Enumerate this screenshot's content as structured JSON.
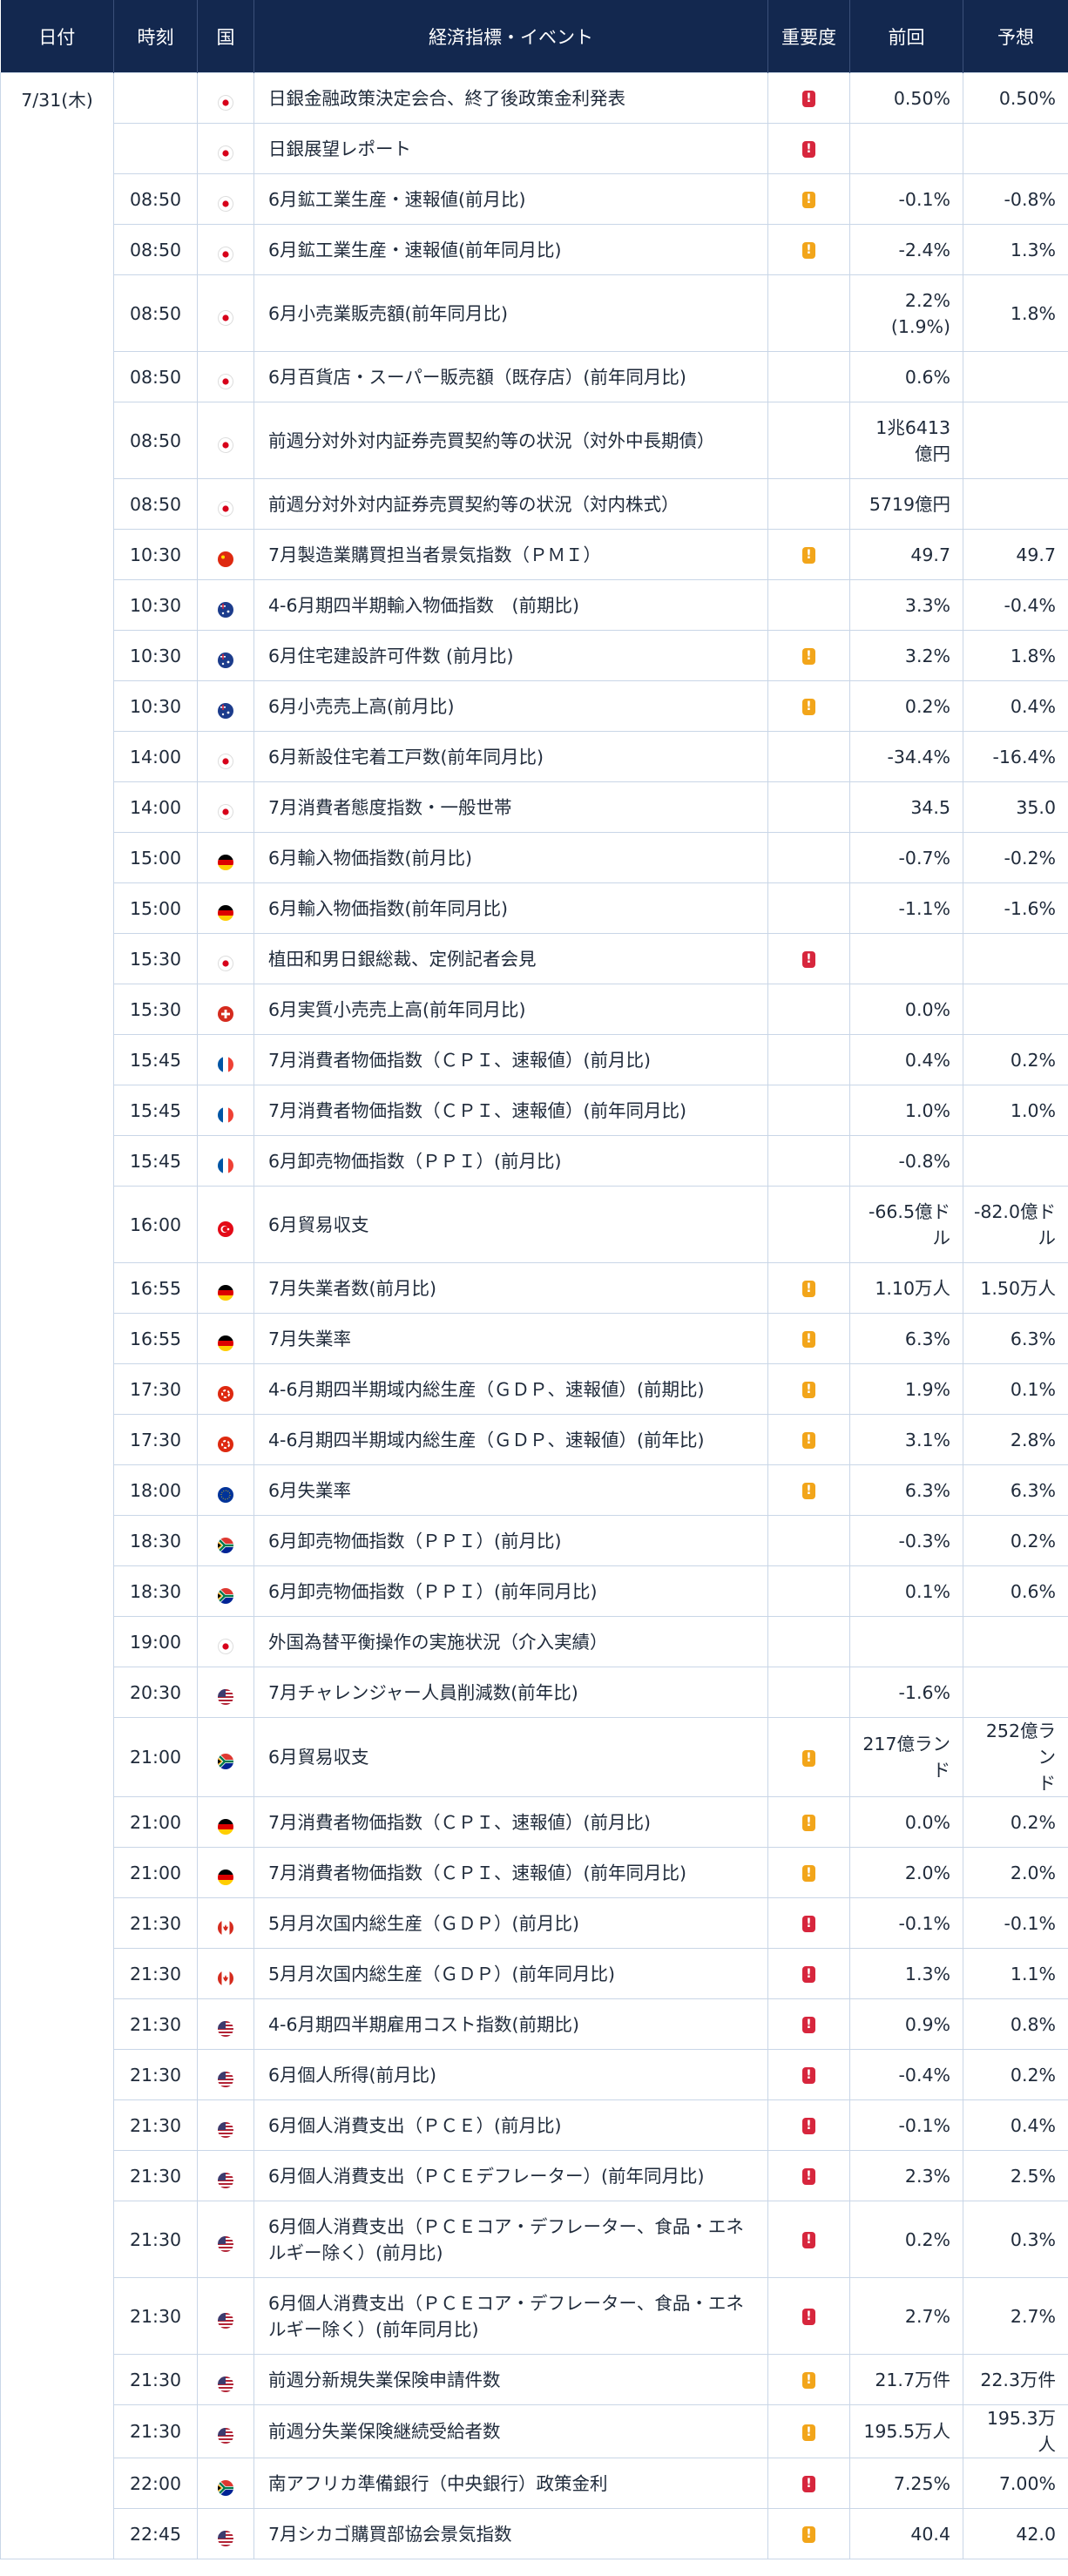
{
  "headers": {
    "date": "日付",
    "time": "時刻",
    "country": "国",
    "event": "経済指標・イベント",
    "importance": "重要度",
    "previous": "前回",
    "forecast": "予想"
  },
  "date": "7/31(木)",
  "flags": {
    "JP": {
      "name": "japan-flag-icon",
      "colors": [
        "#ffffff",
        "#d7001a"
      ]
    },
    "CN": {
      "name": "china-flag-icon",
      "colors": [
        "#de2910",
        "#ffde00"
      ]
    },
    "AU": {
      "name": "australia-flag-icon",
      "colors": [
        "#1c3c8c",
        "#d7263d"
      ]
    },
    "DE": {
      "name": "germany-flag-icon",
      "colors": [
        "#000000",
        "#dd0000",
        "#ffce00"
      ]
    },
    "CH": {
      "name": "switzerland-flag-icon",
      "colors": [
        "#d52b1e",
        "#ffffff"
      ]
    },
    "FR": {
      "name": "france-flag-icon",
      "colors": [
        "#0055a4",
        "#ffffff",
        "#ef4135"
      ]
    },
    "TR": {
      "name": "turkey-flag-icon",
      "colors": [
        "#e30a17",
        "#ffffff"
      ]
    },
    "HK": {
      "name": "hongkong-flag-icon",
      "colors": [
        "#de2910",
        "#ffffff"
      ]
    },
    "EU": {
      "name": "eu-flag-icon",
      "colors": [
        "#003399",
        "#ffcc00"
      ]
    },
    "ZA": {
      "name": "southafrica-flag-icon",
      "colors": [
        "#007a4d",
        "#ffb612",
        "#de3831",
        "#002395"
      ]
    },
    "US": {
      "name": "usa-flag-icon",
      "colors": [
        "#b22234",
        "#ffffff",
        "#3c3b6e"
      ]
    },
    "CA": {
      "name": "canada-flag-icon",
      "colors": [
        "#d52b1e",
        "#ffffff"
      ]
    }
  },
  "importance_colors": {
    "high": "#d7263d",
    "mid": "#f2a51a"
  },
  "importance_glyph": "!",
  "rows": [
    {
      "time": "",
      "country": "JP",
      "event": "日銀金融政策決定会合、終了後政策金利発表",
      "importance": "high",
      "previous": "0.50%",
      "forecast": "0.50%"
    },
    {
      "time": "",
      "country": "JP",
      "event": "日銀展望レポート",
      "importance": "high",
      "previous": "",
      "forecast": ""
    },
    {
      "time": "08:50",
      "country": "JP",
      "event": "6月鉱工業生産・速報値(前月比)",
      "importance": "mid",
      "previous": "-0.1%",
      "forecast": "-0.8%"
    },
    {
      "time": "08:50",
      "country": "JP",
      "event": "6月鉱工業生産・速報値(前年同月比)",
      "importance": "mid",
      "previous": "-2.4%",
      "forecast": "1.3%"
    },
    {
      "time": "08:50",
      "country": "JP",
      "event": "6月小売業販売額(前年同月比)",
      "importance": "",
      "previous": "2.2%\n(1.9%)",
      "forecast": "1.8%",
      "tall": true
    },
    {
      "time": "08:50",
      "country": "JP",
      "event": "6月百貨店・スーパー販売額（既存店）(前年同月比)",
      "importance": "",
      "previous": "0.6%",
      "forecast": ""
    },
    {
      "time": "08:50",
      "country": "JP",
      "event": "前週分対外対内証券売買契約等の状況（対外中長期債）",
      "importance": "",
      "previous": "1兆6413\n億円",
      "forecast": "",
      "tall": true
    },
    {
      "time": "08:50",
      "country": "JP",
      "event": "前週分対外対内証券売買契約等の状況（対内株式）",
      "importance": "",
      "previous": "5719億円",
      "forecast": ""
    },
    {
      "time": "10:30",
      "country": "CN",
      "event": "7月製造業購買担当者景気指数（ＰＭＩ）",
      "importance": "mid",
      "previous": "49.7",
      "forecast": "49.7"
    },
    {
      "time": "10:30",
      "country": "AU",
      "event": "4-6月期四半期輸入物価指数　(前期比)",
      "importance": "",
      "previous": "3.3%",
      "forecast": "-0.4%"
    },
    {
      "time": "10:30",
      "country": "AU",
      "event": "6月住宅建設許可件数 (前月比)",
      "importance": "mid",
      "previous": "3.2%",
      "forecast": "1.8%"
    },
    {
      "time": "10:30",
      "country": "AU",
      "event": "6月小売売上高(前月比)",
      "importance": "mid",
      "previous": "0.2%",
      "forecast": "0.4%"
    },
    {
      "time": "14:00",
      "country": "JP",
      "event": "6月新設住宅着工戸数(前年同月比)",
      "importance": "",
      "previous": "-34.4%",
      "forecast": "-16.4%"
    },
    {
      "time": "14:00",
      "country": "JP",
      "event": "7月消費者態度指数・一般世帯",
      "importance": "",
      "previous": "34.5",
      "forecast": "35.0"
    },
    {
      "time": "15:00",
      "country": "DE",
      "event": "6月輸入物価指数(前月比)",
      "importance": "",
      "previous": "-0.7%",
      "forecast": "-0.2%"
    },
    {
      "time": "15:00",
      "country": "DE",
      "event": "6月輸入物価指数(前年同月比)",
      "importance": "",
      "previous": "-1.1%",
      "forecast": "-1.6%"
    },
    {
      "time": "15:30",
      "country": "JP",
      "event": "植田和男日銀総裁、定例記者会見",
      "importance": "high",
      "previous": "",
      "forecast": ""
    },
    {
      "time": "15:30",
      "country": "CH",
      "event": "6月実質小売売上高(前年同月比)",
      "importance": "",
      "previous": "0.0%",
      "forecast": ""
    },
    {
      "time": "15:45",
      "country": "FR",
      "event": "7月消費者物価指数（ＣＰＩ、速報値）(前月比)",
      "importance": "",
      "previous": "0.4%",
      "forecast": "0.2%"
    },
    {
      "time": "15:45",
      "country": "FR",
      "event": "7月消費者物価指数（ＣＰＩ、速報値）(前年同月比)",
      "importance": "",
      "previous": "1.0%",
      "forecast": "1.0%"
    },
    {
      "time": "15:45",
      "country": "FR",
      "event": "6月卸売物価指数（ＰＰＩ）(前月比)",
      "importance": "",
      "previous": "-0.8%",
      "forecast": ""
    },
    {
      "time": "16:00",
      "country": "TR",
      "event": "6月貿易収支",
      "importance": "",
      "previous": "-66.5億ド\nル",
      "forecast": "-82.0億ド\nル",
      "tall": true
    },
    {
      "time": "16:55",
      "country": "DE",
      "event": "7月失業者数(前月比)",
      "importance": "mid",
      "previous": "1.10万人",
      "forecast": "1.50万人"
    },
    {
      "time": "16:55",
      "country": "DE",
      "event": "7月失業率",
      "importance": "mid",
      "previous": "6.3%",
      "forecast": "6.3%"
    },
    {
      "time": "17:30",
      "country": "HK",
      "event": "4-6月期四半期域内総生産（ＧＤＰ、速報値）(前期比)",
      "importance": "mid",
      "previous": "1.9%",
      "forecast": "0.1%"
    },
    {
      "time": "17:30",
      "country": "HK",
      "event": "4-6月期四半期域内総生産（ＧＤＰ、速報値）(前年比)",
      "importance": "mid",
      "previous": "3.1%",
      "forecast": "2.8%"
    },
    {
      "time": "18:00",
      "country": "EU",
      "event": "6月失業率",
      "importance": "mid",
      "previous": "6.3%",
      "forecast": "6.3%"
    },
    {
      "time": "18:30",
      "country": "ZA",
      "event": "6月卸売物価指数（ＰＰＩ）(前月比)",
      "importance": "",
      "previous": "-0.3%",
      "forecast": "0.2%"
    },
    {
      "time": "18:30",
      "country": "ZA",
      "event": "6月卸売物価指数（ＰＰＩ）(前年同月比)",
      "importance": "",
      "previous": "0.1%",
      "forecast": "0.6%"
    },
    {
      "time": "19:00",
      "country": "JP",
      "event": "外国為替平衡操作の実施状況（介入実績）",
      "importance": "",
      "previous": "",
      "forecast": ""
    },
    {
      "time": "20:30",
      "country": "US",
      "event": "7月チャレンジャー人員削減数(前年比)",
      "importance": "",
      "previous": "-1.6%",
      "forecast": ""
    },
    {
      "time": "21:00",
      "country": "ZA",
      "event": "6月貿易収支",
      "importance": "mid",
      "previous": "217億ラン\nド",
      "forecast": "252億ラン\nド",
      "tall": true
    },
    {
      "time": "21:00",
      "country": "DE",
      "event": "7月消費者物価指数（ＣＰＩ、速報値）(前月比)",
      "importance": "mid",
      "previous": "0.0%",
      "forecast": "0.2%"
    },
    {
      "time": "21:00",
      "country": "DE",
      "event": "7月消費者物価指数（ＣＰＩ、速報値）(前年同月比)",
      "importance": "mid",
      "previous": "2.0%",
      "forecast": "2.0%"
    },
    {
      "time": "21:30",
      "country": "CA",
      "event": "5月月次国内総生産（ＧＤＰ）(前月比)",
      "importance": "high",
      "previous": "-0.1%",
      "forecast": "-0.1%"
    },
    {
      "time": "21:30",
      "country": "CA",
      "event": "5月月次国内総生産（ＧＤＰ）(前年同月比)",
      "importance": "high",
      "previous": "1.3%",
      "forecast": "1.1%"
    },
    {
      "time": "21:30",
      "country": "US",
      "event": "4-6月期四半期雇用コスト指数(前期比)",
      "importance": "high",
      "previous": "0.9%",
      "forecast": "0.8%"
    },
    {
      "time": "21:30",
      "country": "US",
      "event": "6月個人所得(前月比)",
      "importance": "high",
      "previous": "-0.4%",
      "forecast": "0.2%"
    },
    {
      "time": "21:30",
      "country": "US",
      "event": "6月個人消費支出（ＰＣＥ）(前月比)",
      "importance": "high",
      "previous": "-0.1%",
      "forecast": "0.4%"
    },
    {
      "time": "21:30",
      "country": "US",
      "event": "6月個人消費支出（ＰＣＥデフレーター）(前年同月比)",
      "importance": "high",
      "previous": "2.3%",
      "forecast": "2.5%"
    },
    {
      "time": "21:30",
      "country": "US",
      "event": "6月個人消費支出（ＰＣＥコア・デフレーター、食品・エネルギー除く）(前月比)",
      "importance": "high",
      "previous": "0.2%",
      "forecast": "0.3%",
      "tall": true
    },
    {
      "time": "21:30",
      "country": "US",
      "event": "6月個人消費支出（ＰＣＥコア・デフレーター、食品・エネルギー除く）(前年同月比)",
      "importance": "high",
      "previous": "2.7%",
      "forecast": "2.7%",
      "tall": true
    },
    {
      "time": "21:30",
      "country": "US",
      "event": "前週分新規失業保険申請件数",
      "importance": "mid",
      "previous": "21.7万件",
      "forecast": "22.3万件"
    },
    {
      "time": "21:30",
      "country": "US",
      "event": "前週分失業保険継続受給者数",
      "importance": "mid",
      "previous": "195.5万人",
      "forecast": "195.3万人"
    },
    {
      "time": "22:00",
      "country": "ZA",
      "event": "南アフリカ準備銀行（中央銀行）政策金利",
      "importance": "high",
      "previous": "7.25%",
      "forecast": "7.00%"
    },
    {
      "time": "22:45",
      "country": "US",
      "event": "7月シカゴ購買部協会景気指数",
      "importance": "mid",
      "previous": "40.4",
      "forecast": "42.0"
    }
  ]
}
